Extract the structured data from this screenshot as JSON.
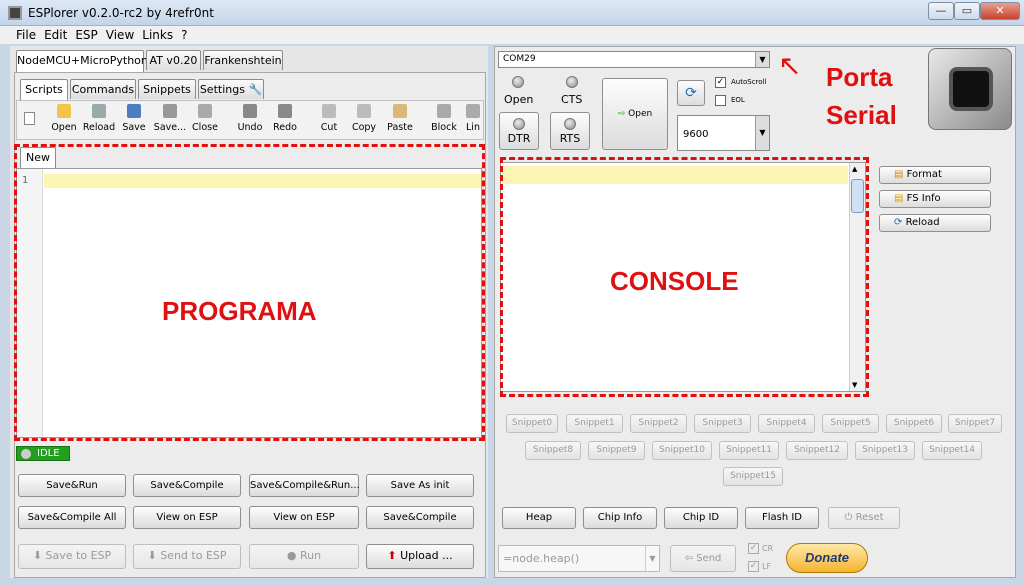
{
  "window": {
    "title": "ESPlorer v0.2.0-rc2 by 4refr0nt",
    "min": "—",
    "max": "▭",
    "close": "✕"
  },
  "menu": [
    "File",
    "Edit",
    "ESP",
    "View",
    "Links",
    "?"
  ],
  "firmware_tabs": [
    "NodeMCU+MicroPython",
    "AT v0.20",
    "Frankenshtein"
  ],
  "sub_tabs": [
    "Scripts",
    "Commands",
    "Snippets",
    "Settings"
  ],
  "toolbar": [
    "Open",
    "Reload",
    "Save",
    "Save...",
    "Close",
    "Undo",
    "Redo",
    "Cut",
    "Copy",
    "Paste",
    "Block",
    "Lin"
  ],
  "editor": {
    "tab": "New",
    "line": "1"
  },
  "annotations": {
    "programa": "PROGRAMA",
    "console": "CONSOLE",
    "porta": "Porta",
    "serial": "Serial"
  },
  "status": "IDLE",
  "left_buttons": [
    "Save&Run",
    "Save&Compile",
    "Save&Compile&Run...",
    "Save As init",
    "Save&Compile All",
    "View on ESP",
    "View on ESP",
    "Save&Compile"
  ],
  "bottom_left": {
    "save_esp": "Save to ESP",
    "send_esp": "Send to ESP",
    "run": "Run",
    "upload": "Upload ..."
  },
  "serial": {
    "port": "COM29",
    "open_led": "Open",
    "cts": "CTS",
    "dtr": "DTR",
    "rts": "RTS",
    "open_btn": "Open",
    "autoscroll": "AutoScroll",
    "eol": "EOL",
    "baud": "9600"
  },
  "side_buttons": [
    "Format",
    "FS Info",
    "Reload"
  ],
  "snippets_row1": [
    "Snippet0",
    "Snippet1",
    "Snippet2",
    "Snippet3",
    "Snippet4",
    "Snippet5",
    "Snippet6",
    "Snippet7"
  ],
  "snippets_row2": [
    "Snippet8",
    "Snippet9",
    "Snippet10",
    "Snippet11",
    "Snippet12",
    "Snippet13",
    "Snippet14"
  ],
  "snippets_row3": [
    "Snippet15"
  ],
  "bottom_right": {
    "heap": "Heap",
    "chip_info": "Chip Info",
    "chip_id": "Chip ID",
    "flash_id": "Flash ID",
    "reset": "Reset",
    "cmd": "=node.heap()",
    "send": "Send",
    "cr": "CR",
    "lf": "LF",
    "donate": "Donate"
  }
}
